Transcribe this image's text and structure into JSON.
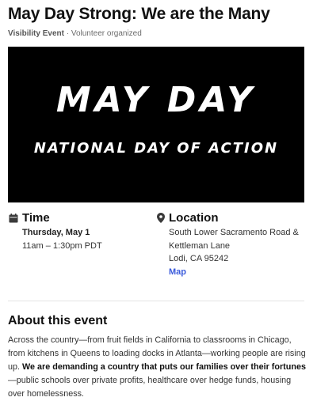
{
  "event": {
    "title": "May Day Strong: We are the Many",
    "type": "Visibility Event",
    "separator": " · ",
    "organizer": "Volunteer organized"
  },
  "hero": {
    "line1": "MAY DAY",
    "line2": "NATIONAL DAY OF ACTION"
  },
  "time": {
    "heading": "Time",
    "date": "Thursday, May 1",
    "hours": "11am – 1:30pm PDT",
    "icon": "calendar-icon"
  },
  "location": {
    "heading": "Location",
    "line1": "South Lower Sacramento Road &",
    "line2": "Kettleman Lane",
    "line3": "Lodi, CA 95242",
    "map_link": "Map",
    "icon": "location-pin-icon"
  },
  "about": {
    "heading": "About this event",
    "text_start": "Across the country—from fruit fields in California to classrooms in Chicago, from kitchens in Queens to loading docks in Atlanta—working people are rising up. ",
    "text_bold": "We are demanding a country that puts our families over their fortunes",
    "text_end": "—public schools over private profits, healthcare over hedge funds, housing over homelessness."
  },
  "colors": {
    "link": "#3b5bdb",
    "hero_background": "#000000",
    "hero_text": "#ffffff"
  }
}
